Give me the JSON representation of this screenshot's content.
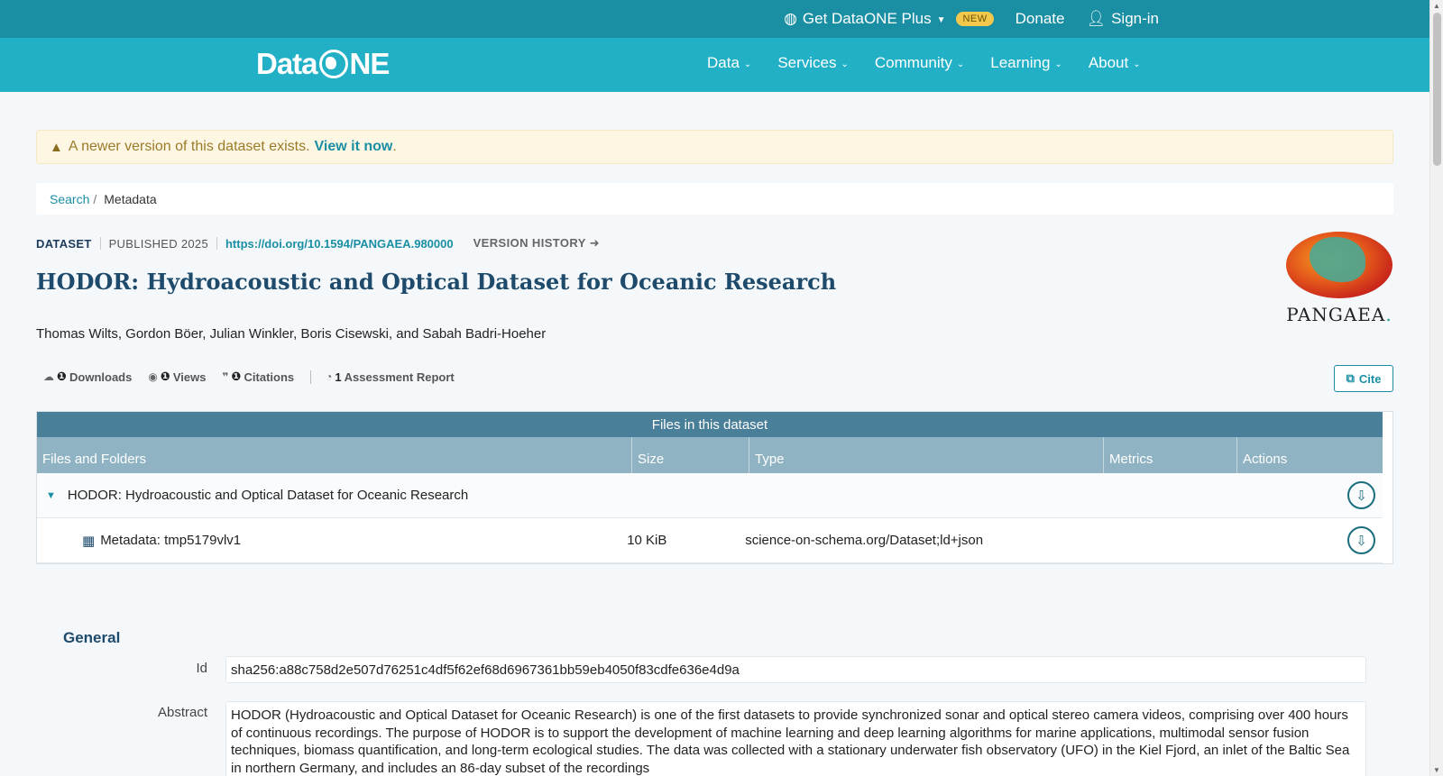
{
  "topbar": {
    "plus_label": "Get DataONE Plus",
    "new_badge": "NEW",
    "donate_label": "Donate",
    "signin_label": "Sign-in"
  },
  "nav": {
    "logo_left": "Data",
    "logo_right": "NE",
    "items": [
      "Data",
      "Services",
      "Community",
      "Learning",
      "About"
    ]
  },
  "alert": {
    "text": "A newer version of this dataset exists.",
    "link": "View it now",
    "end": "."
  },
  "breadcrumb": {
    "search": "Search",
    "sep": "/",
    "current": "Metadata"
  },
  "dataset": {
    "type_label": "DATASET",
    "published": "PUBLISHED 2025",
    "doi": "https://doi.org/10.1594/PANGAEA.980000",
    "version_history": "VERSION HISTORY",
    "title": "HODOR: Hydroacoustic and Optical Dataset for Oceanic Research",
    "authors": "Thomas Wilts, Gordon Böer, Julian Winkler, Boris Cisewski, and Sabah Badri-Hoeher",
    "repository_logo_text": "PANGAEA",
    "repository_logo_dot": "."
  },
  "metrics": {
    "downloads_label": "Downloads",
    "views_label": "Views",
    "citations_label": "Citations",
    "assessment_count": "1",
    "assessment_label": "Assessment Report",
    "cite_label": "Cite"
  },
  "files": {
    "caption": "Files in this dataset",
    "columns": [
      "Files and Folders",
      "Size",
      "Type",
      "Metrics",
      "Actions"
    ],
    "folder_name": "HODOR: Hydroacoustic and Optical Dataset for Oceanic Research",
    "file_name": "Metadata: tmp5179vlv1",
    "file_size": "10 KiB",
    "file_type": "science-on-schema.org/Dataset;ld+json"
  },
  "general": {
    "heading": "General",
    "id_label": "Id",
    "id_value": "sha256:a88c758d2e507d76251c4df5f62ef68d6967361bb59eb4050f83cdfe636e4d9a",
    "abstract_label": "Abstract",
    "abstract_value": "HODOR (Hydroacoustic and Optical Dataset for Oceanic Research) is one of the first datasets to provide synchronized sonar and optical stereo camera videos, comprising over 400 hours of continuous recordings. The purpose of HODOR is to support the development of machine learning and deep learning algorithms for marine applications, multimodal sensor fusion techniques, biomass quantification, and long-term ecological studies. The data was collected with a stationary underwater fish observatory (UFO) in the Kiel Fjord, an inlet of the Baltic Sea in northern Germany, and includes an 86-day subset of the recordings"
  },
  "colors": {
    "topbar": "#1a8fa3",
    "navbar": "#22b0c7",
    "accent": "#1a8fa3",
    "title": "#1e4a6b",
    "table_caption": "#4a7f99",
    "table_header": "#8fb3c3",
    "alert_bg": "#fdf6e3"
  }
}
